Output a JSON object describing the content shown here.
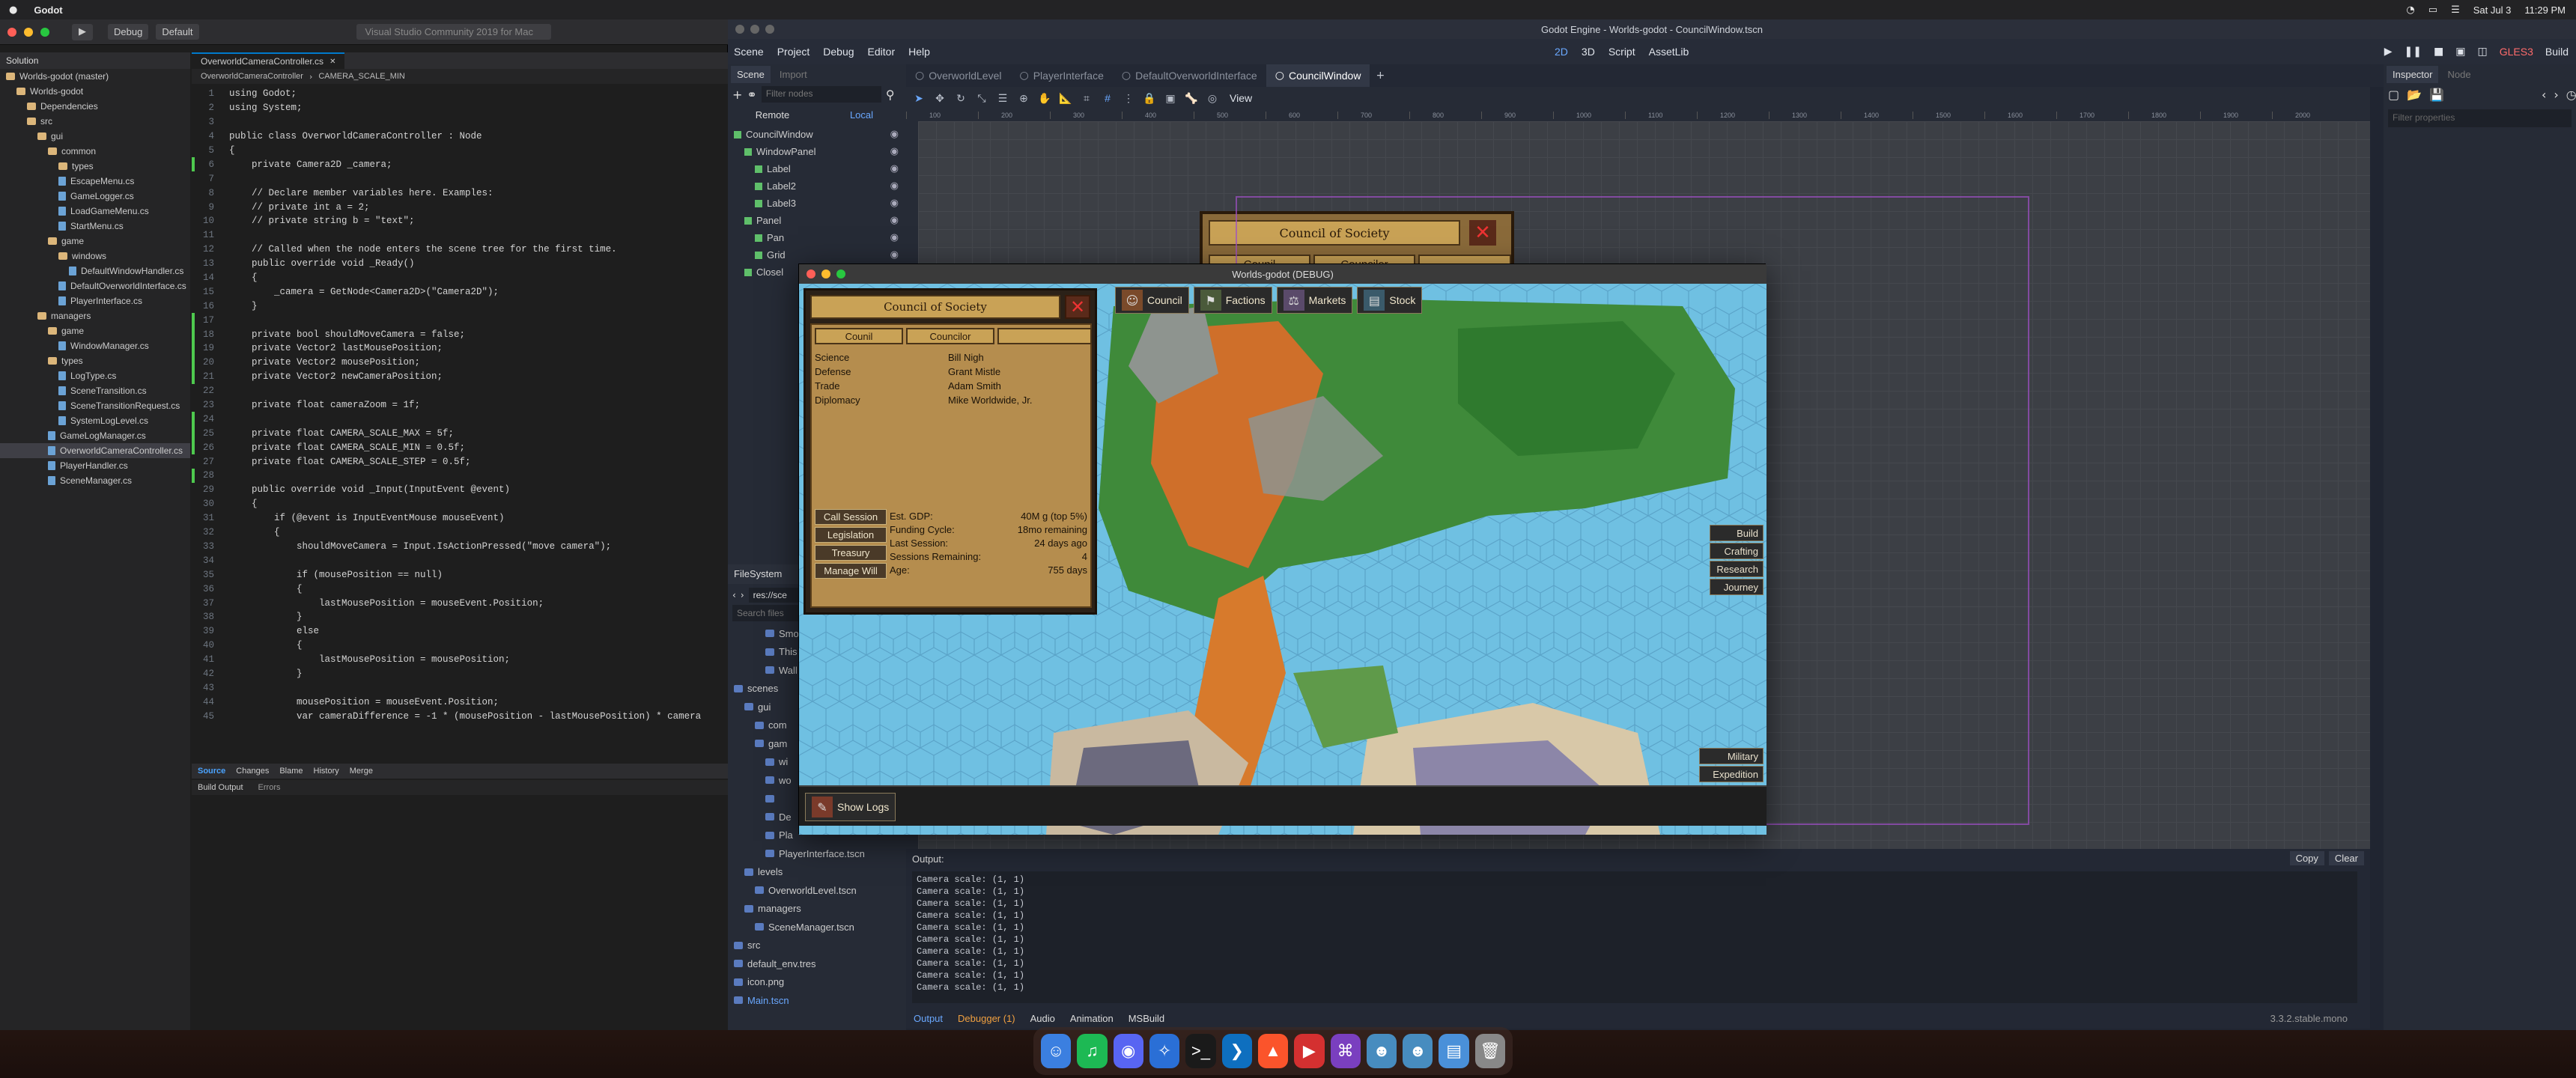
{
  "menubar": {
    "app": "Godot",
    "right_items": [
      "Sat Jul 3",
      "11:29 PM"
    ]
  },
  "vs": {
    "config": "Debug",
    "target": "Default",
    "search_placeholder": "Visual Studio Community 2019 for Mac",
    "solution_header": "Solution",
    "tree": [
      {
        "label": "Worlds-godot (master)",
        "depth": 0,
        "kind": "folder"
      },
      {
        "label": "Worlds-godot",
        "depth": 1,
        "kind": "folder"
      },
      {
        "label": "Dependencies",
        "depth": 2,
        "kind": "folder"
      },
      {
        "label": "src",
        "depth": 2,
        "kind": "folder"
      },
      {
        "label": "gui",
        "depth": 3,
        "kind": "folder"
      },
      {
        "label": "common",
        "depth": 4,
        "kind": "folder"
      },
      {
        "label": "types",
        "depth": 5,
        "kind": "folder"
      },
      {
        "label": "EscapeMenu.cs",
        "depth": 5,
        "kind": "file"
      },
      {
        "label": "GameLogger.cs",
        "depth": 5,
        "kind": "file"
      },
      {
        "label": "LoadGameMenu.cs",
        "depth": 5,
        "kind": "file"
      },
      {
        "label": "StartMenu.cs",
        "depth": 5,
        "kind": "file"
      },
      {
        "label": "game",
        "depth": 4,
        "kind": "folder"
      },
      {
        "label": "windows",
        "depth": 5,
        "kind": "folder"
      },
      {
        "label": "DefaultWindowHandler.cs",
        "depth": 6,
        "kind": "file"
      },
      {
        "label": "DefaultOverworldInterface.cs",
        "depth": 5,
        "kind": "file"
      },
      {
        "label": "PlayerInterface.cs",
        "depth": 5,
        "kind": "file"
      },
      {
        "label": "managers",
        "depth": 3,
        "kind": "folder"
      },
      {
        "label": "game",
        "depth": 4,
        "kind": "folder"
      },
      {
        "label": "WindowManager.cs",
        "depth": 5,
        "kind": "file"
      },
      {
        "label": "types",
        "depth": 4,
        "kind": "folder"
      },
      {
        "label": "LogType.cs",
        "depth": 5,
        "kind": "file"
      },
      {
        "label": "SceneTransition.cs",
        "depth": 5,
        "kind": "file"
      },
      {
        "label": "SceneTransitionRequest.cs",
        "depth": 5,
        "kind": "file"
      },
      {
        "label": "SystemLogLevel.cs",
        "depth": 5,
        "kind": "file"
      },
      {
        "label": "GameLogManager.cs",
        "depth": 4,
        "kind": "file"
      },
      {
        "label": "OverworldCameraController.cs",
        "depth": 4,
        "kind": "file",
        "selected": true
      },
      {
        "label": "PlayerHandler.cs",
        "depth": 4,
        "kind": "file"
      },
      {
        "label": "SceneManager.cs",
        "depth": 4,
        "kind": "file"
      }
    ],
    "editor_tab": "OverworldCameraController.cs",
    "crumbs": [
      "OverworldCameraController",
      "CAMERA_SCALE_MIN"
    ],
    "code": [
      "using Godot;",
      "using System;",
      "",
      "public class OverworldCameraController : Node",
      "{",
      "    private Camera2D _camera;",
      "",
      "    // Declare member variables here. Examples:",
      "    // private int a = 2;",
      "    // private string b = \"text\";",
      "",
      "    // Called when the node enters the scene tree for the first time.",
      "    public override void _Ready()",
      "    {",
      "        _camera = GetNode<Camera2D>(\"Camera2D\");",
      "    }",
      "",
      "    private bool shouldMoveCamera = false;",
      "    private Vector2 lastMousePosition;",
      "    private Vector2 mousePosition;",
      "    private Vector2 newCameraPosition;",
      "",
      "    private float cameraZoom = 1f;",
      "",
      "    private float CAMERA_SCALE_MAX = 5f;",
      "    private float CAMERA_SCALE_MIN = 0.5f;",
      "    private float CAMERA_SCALE_STEP = 0.5f;",
      "",
      "    public override void _Input(InputEvent @event)",
      "    {",
      "        if (@event is InputEventMouse mouseEvent)",
      "        {",
      "            shouldMoveCamera = Input.IsActionPressed(\"move camera\");",
      "",
      "            if (mousePosition == null)",
      "            {",
      "                lastMousePosition = mouseEvent.Position;",
      "            }",
      "            else",
      "            {",
      "                lastMousePosition = mousePosition;",
      "            }",
      "",
      "            mousePosition = mouseEvent.Position;",
      "            var cameraDifference = -1 * (mousePosition - lastMousePosition) * camera"
    ],
    "bottom_tabs": [
      "Source",
      "Changes",
      "Blame",
      "History",
      "Merge"
    ],
    "build_tabs": [
      "Build Output",
      "Errors"
    ]
  },
  "godot": {
    "title": "Godot Engine - Worlds-godot - CouncilWindow.tscn",
    "menu": [
      "Scene",
      "Project",
      "Debug",
      "Editor",
      "Help"
    ],
    "workspaces": [
      "2D",
      "3D",
      "Script",
      "AssetLib"
    ],
    "renderer": "GLES3",
    "build_label": "Build",
    "dock_tabs": [
      "Scene",
      "Import"
    ],
    "filter_placeholder": "Filter nodes",
    "remote_local": [
      "Remote",
      "Local"
    ],
    "scene_tree": [
      {
        "label": "CouncilWindow",
        "depth": 0
      },
      {
        "label": "WindowPanel",
        "depth": 1
      },
      {
        "label": "Label",
        "depth": 2
      },
      {
        "label": "Label2",
        "depth": 2
      },
      {
        "label": "Label3",
        "depth": 2
      },
      {
        "label": "Panel",
        "depth": 1
      },
      {
        "label": "Pan",
        "depth": 2
      },
      {
        "label": "Grid",
        "depth": 2
      },
      {
        "label": "Closel",
        "depth": 1
      }
    ],
    "filesystem_header": "FileSystem",
    "fs_path": "res://sce",
    "fs_search_placeholder": "Search files",
    "fs_items": [
      {
        "label": "Smo",
        "depth": 3
      },
      {
        "label": "This",
        "depth": 3
      },
      {
        "label": "Wall",
        "depth": 3
      },
      {
        "label": "scenes",
        "depth": 0
      },
      {
        "label": "gui",
        "depth": 1
      },
      {
        "label": "com",
        "depth": 2
      },
      {
        "label": "gam",
        "depth": 2
      },
      {
        "label": "wi",
        "depth": 3
      },
      {
        "label": "wo",
        "depth": 3
      },
      {
        "label": "",
        "depth": 3
      },
      {
        "label": "De",
        "depth": 3
      },
      {
        "label": "Pla",
        "depth": 3
      },
      {
        "label": "PlayerInterface.tscn",
        "depth": 3
      },
      {
        "label": "levels",
        "depth": 1
      },
      {
        "label": "OverworldLevel.tscn",
        "depth": 2
      },
      {
        "label": "managers",
        "depth": 1
      },
      {
        "label": "SceneManager.tscn",
        "depth": 2
      },
      {
        "label": "src",
        "depth": 0
      },
      {
        "label": "default_env.tres",
        "depth": 0
      },
      {
        "label": "icon.png",
        "depth": 0
      },
      {
        "label": "Main.tscn",
        "depth": 0,
        "highlight": true
      }
    ],
    "scene_tabs": [
      "OverworldLevel",
      "PlayerInterface",
      "DefaultOverworldInterface",
      "CouncilWindow"
    ],
    "view_label": "View",
    "ruler_ticks": [
      "100",
      "200",
      "300",
      "400",
      "500",
      "600",
      "700",
      "800",
      "900",
      "1000",
      "1100",
      "1200",
      "1300",
      "1400",
      "1500",
      "1600",
      "1700",
      "1800",
      "1900",
      "2000"
    ],
    "inspector_tabs": [
      "Inspector",
      "Node"
    ],
    "inspector_filter_placeholder": "Filter properties",
    "output_label": "Output:",
    "copy": "Copy",
    "clear": "Clear",
    "output_lines": [
      "Camera scale: (1, 1)",
      "Camera scale: (1, 1)",
      "Camera scale: (1, 1)",
      "Camera scale: (1, 1)",
      "Camera scale: (1, 1)",
      "Camera scale: (1, 1)",
      "Camera scale: (1, 1)",
      "Camera scale: (1, 1)",
      "Camera scale: (1, 1)",
      "Camera scale: (1, 1)"
    ],
    "bottom_tabs": [
      "Output",
      "Debugger (1)",
      "Audio",
      "Animation",
      "MSBuild"
    ],
    "version": "3.3.2.stable.mono",
    "bg_window_title": "Council of Society",
    "bg_col1": "Counil",
    "bg_col2": "Councilor"
  },
  "game": {
    "title": "Worlds-godot (DEBUG)",
    "top_tabs": [
      "Council",
      "Factions",
      "Markets",
      "Stock"
    ],
    "council_title": "Council of Society",
    "col_headers": [
      "Counil",
      "Councilor",
      ""
    ],
    "members": [
      {
        "role": "Science",
        "name": "Bill Nigh"
      },
      {
        "role": "Defense",
        "name": "Grant Mistle"
      },
      {
        "role": "Trade",
        "name": "Adam Smith"
      },
      {
        "role": "Diplomacy",
        "name": "Mike Worldwide, Jr."
      }
    ],
    "actions": [
      "Call Session",
      "Legislation",
      "Treasury",
      "Manage Will"
    ],
    "stats": [
      {
        "k": "Est. GDP:",
        "v": "40M g (top 5%)"
      },
      {
        "k": "Funding Cycle:",
        "v": "18mo remaining"
      },
      {
        "k": "Last Session:",
        "v": "24 days ago"
      },
      {
        "k": "Sessions Remaining:",
        "v": "4"
      },
      {
        "k": "Age:",
        "v": "755 days"
      }
    ],
    "right_buttons": [
      "Build",
      "Crafting",
      "Research",
      "Journey"
    ],
    "bottom_right_buttons": [
      "Military",
      "Expedition"
    ],
    "show_logs": "Show Logs"
  },
  "colors": {
    "accent": "#5aa0ff",
    "parchment": "#b58d4e",
    "ocean": "#6fb9dd",
    "forest": "#3f8a3a"
  }
}
